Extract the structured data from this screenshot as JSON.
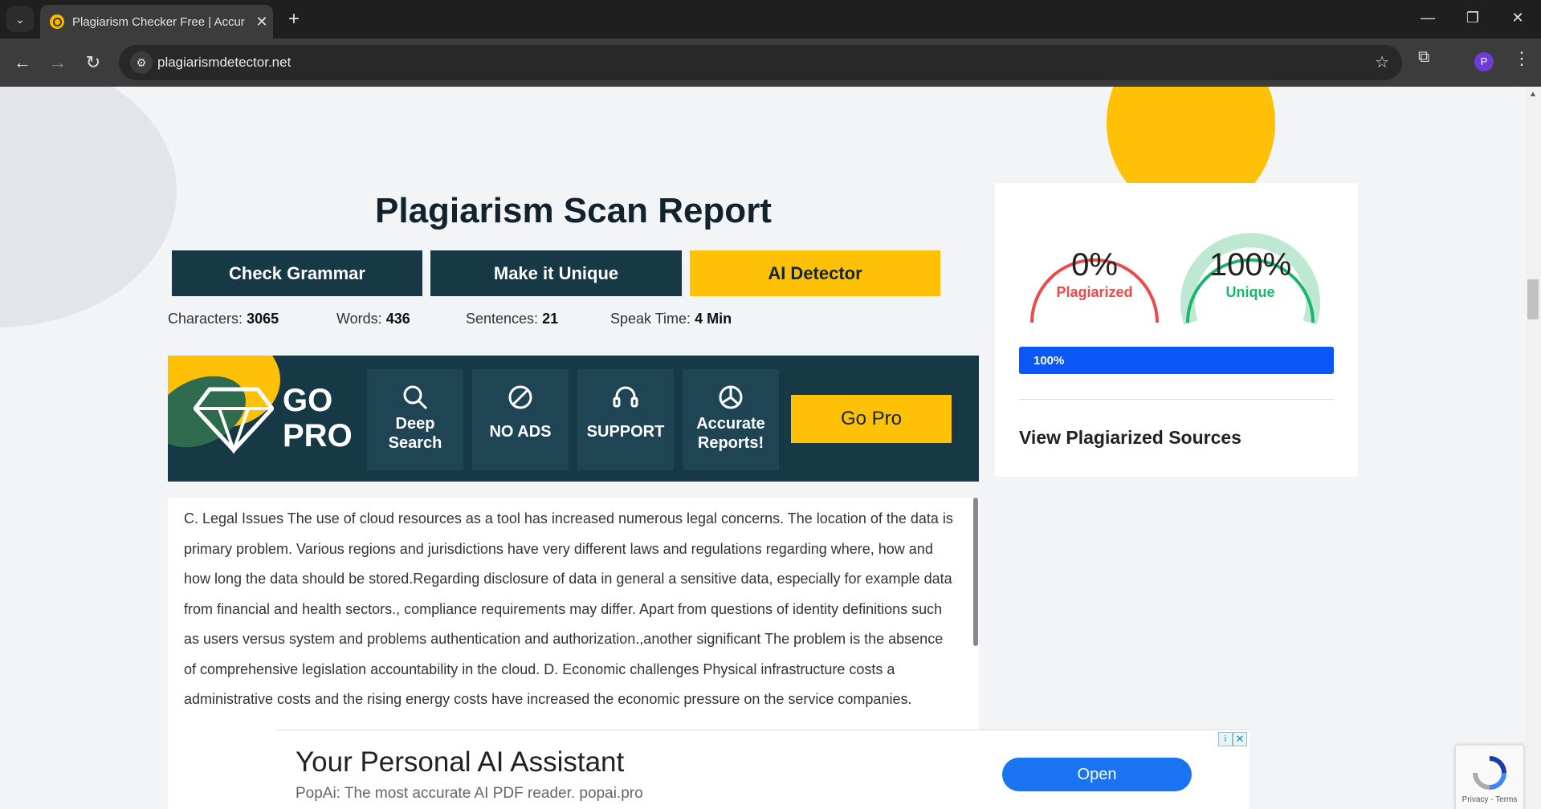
{
  "browser": {
    "tab_title": "Plagiarism Checker Free | Accur",
    "url": "plagiarismdetector.net",
    "profile_initial": "P"
  },
  "page": {
    "title": "Plagiarism Scan Report",
    "buttons": {
      "check_grammar": "Check Grammar",
      "make_unique": "Make it Unique",
      "ai_detector": "AI Detector"
    },
    "stats": {
      "characters_label": "Characters:",
      "characters_value": "3065",
      "words_label": "Words:",
      "words_value": "436",
      "sentences_label": "Sentences:",
      "sentences_value": "21",
      "speak_label": "Speak Time:",
      "speak_value": "4 Min"
    },
    "promo": {
      "go": "GO",
      "pro": "PRO",
      "features": [
        {
          "label": "Deep Search",
          "icon": "search-icon"
        },
        {
          "label": "NO ADS",
          "icon": "no-ads-icon"
        },
        {
          "label": "SUPPORT",
          "icon": "headset-icon"
        },
        {
          "label": "Accurate Reports!",
          "icon": "pie-chart-icon"
        }
      ],
      "go_pro_button": "Go Pro"
    },
    "text_content": "C. Legal Issues The use of cloud resources as a tool has increased numerous legal concerns. The location of the data is primary problem. Various regions and jurisdictions have very different laws and regulations regarding where, how and how long the data should be stored.Regarding disclosure of data in general a sensitive data, especially for example data from financial and health sectors., compliance requirements may differ. Apart from questions of identity definitions such as users versus system and problems authentication and authorization.,another significant The problem is the absence of comprehensive legislation accountability in the cloud. D. Economic challenges Physical infrastructure costs a administrative costs and the rising energy costs have increased the economic pressure on the service companies."
  },
  "results": {
    "plagiarized_pct": "0%",
    "plagiarized_label": "Plagiarized",
    "unique_pct": "100%",
    "unique_label": "Unique",
    "progress_text": "100%",
    "progress_value": 1.0,
    "view_sources": "View Plagiarized Sources",
    "colors": {
      "plagiarized": "#e84c4c",
      "unique": "#1db56b",
      "progress": "#0a57f5"
    }
  },
  "ad": {
    "headline": "Your Personal AI Assistant",
    "subtext": "PopAi: The most accurate AI PDF reader. popai.pro",
    "open_button": "Open"
  },
  "recaptcha": {
    "text": "Privacy - Terms"
  }
}
